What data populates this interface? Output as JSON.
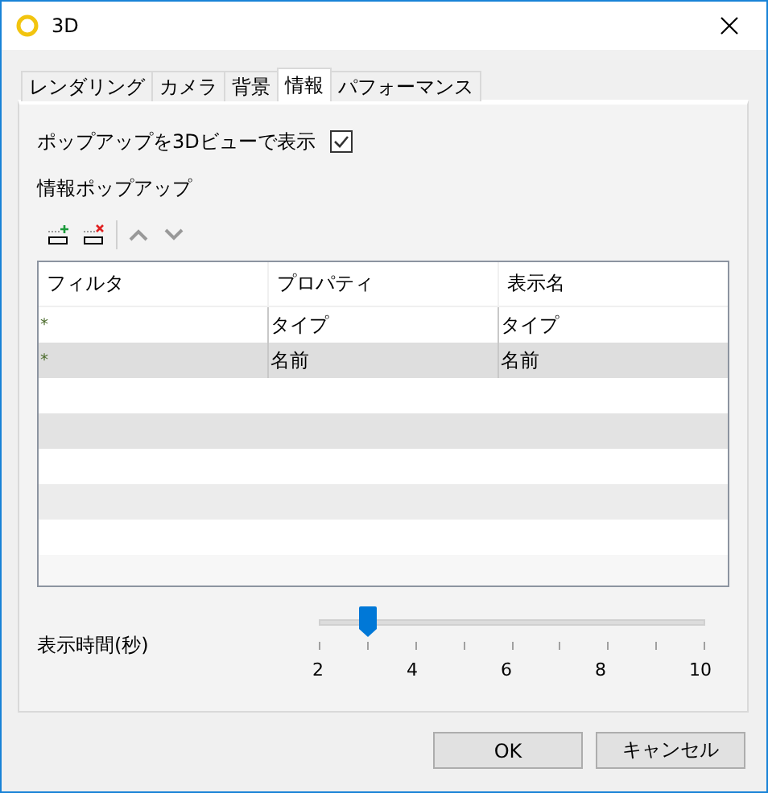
{
  "window": {
    "title": "3D"
  },
  "tabs": [
    {
      "label": "レンダリング",
      "selected": false
    },
    {
      "label": "カメラ",
      "selected": false
    },
    {
      "label": "背景",
      "selected": false
    },
    {
      "label": "情報",
      "selected": true
    },
    {
      "label": "パフォーマンス",
      "selected": false
    }
  ],
  "show_popup": {
    "label": "ポップアップを3Dビューで表示",
    "checked": true
  },
  "popup_section": {
    "label": "情報ポップアップ"
  },
  "table": {
    "columns": [
      "フィルタ",
      "プロパティ",
      "表示名"
    ],
    "rows": [
      {
        "cells": [
          "*",
          "タイプ",
          "タイプ"
        ],
        "selected": false
      },
      {
        "cells": [
          "*",
          "名前",
          "名前"
        ],
        "selected": true
      }
    ]
  },
  "duration": {
    "label": "表示時間(秒)",
    "level": 0.125,
    "tick_labels": [
      "2",
      "4",
      "6",
      "8",
      "10"
    ]
  },
  "buttons": [
    "OK",
    "キャンセル"
  ]
}
